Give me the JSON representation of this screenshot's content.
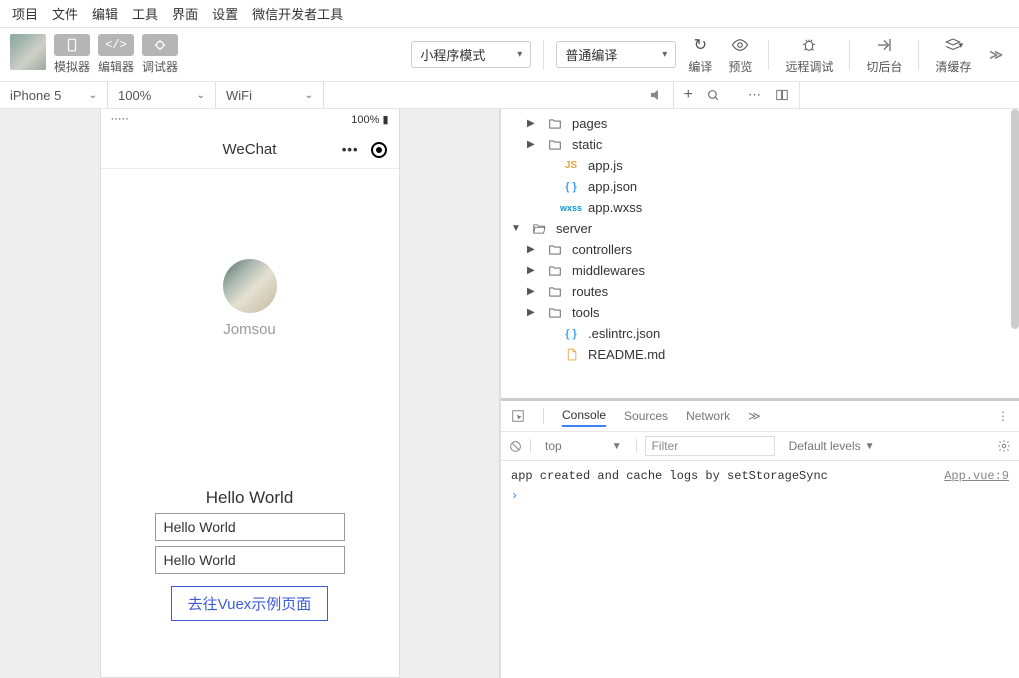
{
  "menubar": {
    "items": [
      "项目",
      "文件",
      "编辑",
      "工具",
      "界面",
      "设置",
      "微信开发者工具"
    ]
  },
  "toolbar": {
    "buttons": [
      {
        "label": "模拟器"
      },
      {
        "label": "编辑器"
      },
      {
        "label": "调试器"
      }
    ],
    "mode_dropdown": "小程序模式",
    "compile_dropdown": "普通编译",
    "actions": [
      {
        "label": "编译",
        "icon": "↻"
      },
      {
        "label": "预览",
        "icon": "👁"
      },
      {
        "label": "远程调试",
        "icon": "🐞"
      },
      {
        "label": "切后台",
        "icon": "⤴"
      },
      {
        "label": "清缓存",
        "icon": "≋"
      }
    ]
  },
  "devicebar": {
    "device": "iPhone 5",
    "zoom": "100%",
    "network": "WiFi"
  },
  "phone": {
    "status_right": "100%",
    "header_title": "WeChat",
    "username": "Jomsou",
    "hello_title": "Hello World",
    "input1": "Hello World",
    "input2": "Hello World",
    "button_label": "去往Vuex示例页面"
  },
  "tree": {
    "items": [
      {
        "indent": 1,
        "arrow": "closed",
        "icon": "folder",
        "label": "pages"
      },
      {
        "indent": 1,
        "arrow": "closed",
        "icon": "folder",
        "label": "static"
      },
      {
        "indent": 2,
        "arrow": "none",
        "icon": "js",
        "label": "app.js"
      },
      {
        "indent": 2,
        "arrow": "none",
        "icon": "json",
        "label": "app.json"
      },
      {
        "indent": 2,
        "arrow": "none",
        "icon": "wxss",
        "label": "app.wxss"
      },
      {
        "indent": 0,
        "arrow": "open",
        "icon": "folder-open",
        "label": "server"
      },
      {
        "indent": 1,
        "arrow": "closed",
        "icon": "folder",
        "label": "controllers"
      },
      {
        "indent": 1,
        "arrow": "closed",
        "icon": "folder",
        "label": "middlewares"
      },
      {
        "indent": 1,
        "arrow": "closed",
        "icon": "folder",
        "label": "routes"
      },
      {
        "indent": 1,
        "arrow": "closed",
        "icon": "folder",
        "label": "tools"
      },
      {
        "indent": 2,
        "arrow": "none",
        "icon": "json",
        "label": ".eslintrc.json"
      },
      {
        "indent": 2,
        "arrow": "none",
        "icon": "file",
        "label": "README.md"
      }
    ]
  },
  "devtools": {
    "tabs": [
      "Console",
      "Sources",
      "Network"
    ],
    "active_tab": "Console",
    "context": "top",
    "filter_placeholder": "Filter",
    "levels": "Default levels",
    "log_msg": "app created and cache logs by setStorageSync",
    "log_src": "App.vue:9"
  }
}
